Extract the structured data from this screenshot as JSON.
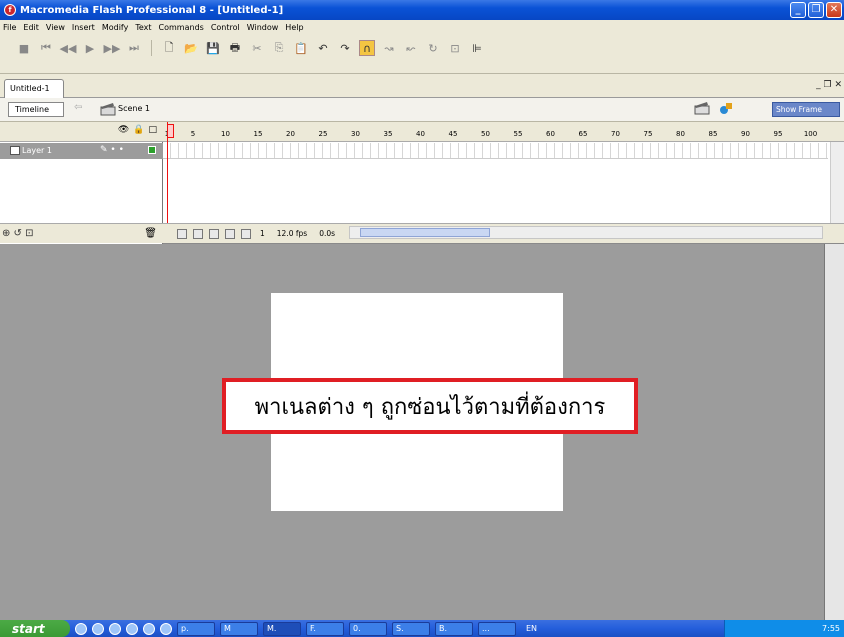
{
  "window": {
    "title": "Macromedia Flash Professional 8 - [Untitled-1]"
  },
  "menu": [
    "File",
    "Edit",
    "View",
    "Insert",
    "Modify",
    "Text",
    "Commands",
    "Control",
    "Window",
    "Help"
  ],
  "document": {
    "tab_label": "Untitled-1"
  },
  "editbar": {
    "timeline_button": "Timeline",
    "scene_label": "Scene 1",
    "zoom_value": "Show Frame"
  },
  "timeline": {
    "ruler_labels": [
      "1",
      "5",
      "10",
      "15",
      "20",
      "25",
      "30",
      "35",
      "40",
      "45",
      "50",
      "55",
      "60",
      "65",
      "70",
      "75",
      "80",
      "85",
      "90",
      "95",
      "100"
    ],
    "layer_name": "Layer 1",
    "current_frame": "1",
    "frame_rate": "12.0 fps",
    "elapsed_time": "0.0s"
  },
  "stage": {
    "callout_text": "พาเนลต่าง ๆ ถูกซ่อนไว้ตามที่ต้องการ"
  },
  "taskbar": {
    "start_label": "start",
    "items": [
      "p.",
      "M",
      "M.",
      "F.",
      "0.",
      "S.",
      "B.",
      "..."
    ],
    "language": "EN",
    "clock": "7:55"
  },
  "colors": {
    "callout_border": "#e01e24",
    "titlebar": "#0a52d6",
    "stage_bg": "#9c9c9c",
    "playhead": "#e11111"
  }
}
